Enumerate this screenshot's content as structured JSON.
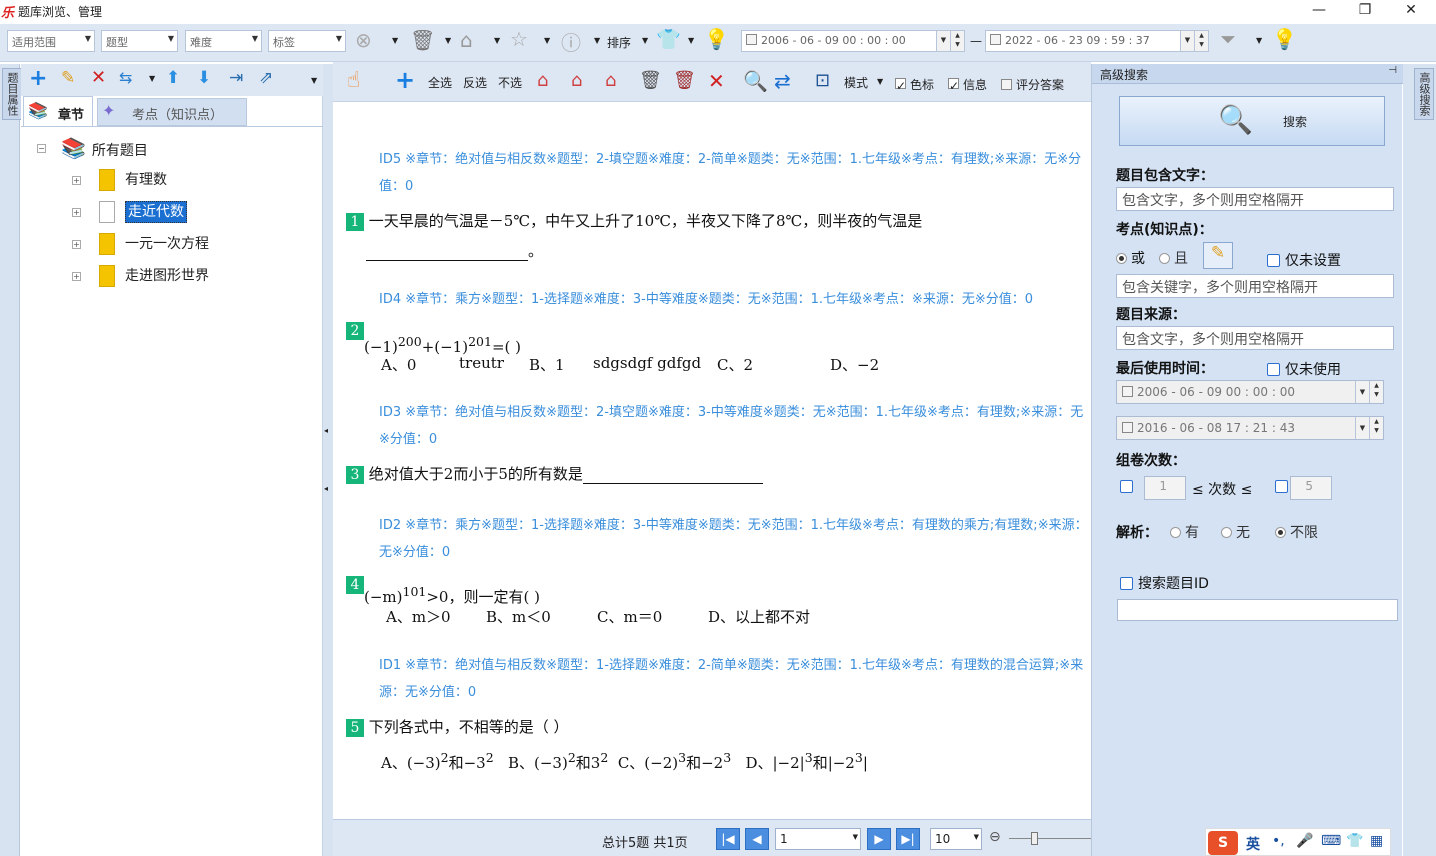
{
  "window": {
    "title": "题库浏览、管理",
    "logo": "乐",
    "min": "—",
    "max": "❐",
    "close": "✕"
  },
  "filters": {
    "scope": "适用范围",
    "qtype": "题型",
    "difficulty": "难度",
    "tag": "标签",
    "sort": "排序",
    "date_start": "2006 - 06 - 09     00 : 00 : 00",
    "date_dash": "—",
    "date_end": "2022 - 06 - 23     09 : 59 : 37"
  },
  "left_strip": {
    "label": "题目属性"
  },
  "left": {
    "tab_chapter": "章节",
    "tab_point": "考点（知识点）",
    "tree": {
      "root": "所有题目",
      "children": [
        "有理数",
        "走近代数",
        "一元一次方程",
        "走进图形世界"
      ]
    }
  },
  "center_tool": {
    "select_all": "全选",
    "invert": "反选",
    "select_none": "不选",
    "mode": "模式",
    "color": "色标",
    "info": "信息",
    "score_answer": "评分答案"
  },
  "questions": [
    {
      "meta": "ID5 ※章节：绝对值与相反数※题型：2-填空题※难度：2-简单※题类：无※范围：1.七年级※考点：有理数;※来源：无※分值：0",
      "num": "1",
      "text": "一天早晨的气温是－5℃，中午又上升了10℃，半夜又下降了8℃，则半夜的气温是",
      "tail": "。"
    },
    {
      "meta": "ID4 ※章节：乘方※题型：1-选择题※难度：3-中等难度※题类：无※范围：1.七年级※考点：※来源：无※分值：0",
      "num": "2",
      "base1": "(−1)",
      "exp1": "200",
      "plus": "+(−1)",
      "exp2": "201",
      "eq": "=(      )",
      "opts": [
        "A、0",
        "treutr",
        "B、1",
        "sdgsdgf gdfgd",
        "C、2",
        "D、−2"
      ]
    },
    {
      "meta": "ID3 ※章节：绝对值与相反数※题型：2-填空题※难度：3-中等难度※题类：无※范围：1.七年级※考点：有理数;※来源：无※分值：0",
      "num": "3",
      "text": "绝对值大于2而小于5的所有数是"
    },
    {
      "meta": "ID2 ※章节：乘方※题型：1-选择题※难度：3-中等难度※题类：无※范围：1.七年级※考点：有理数的乘方;有理数;※来源：无※分值：0",
      "num": "4",
      "base": "(−m)",
      "exp": "101",
      "rest": ">0，则一定有(        )",
      "opts": [
        "A、m＞0",
        "B、m＜0",
        "C、m＝0",
        "D、以上都不对"
      ]
    },
    {
      "meta": "ID1 ※章节：绝对值与相反数※题型：1-选择题※难度：2-简单※题类：无※范围：1.七年级※考点：有理数的混合运算;※来源：无※分值：0",
      "num": "5",
      "text": "下列各式中，不相等的是（      ）"
    }
  ],
  "pager": {
    "summary": "总计5题  共1页",
    "page": "1",
    "page_size": "10"
  },
  "right": {
    "header": "高级搜索",
    "search_btn": "搜索",
    "contains_label": "题目包含文字：",
    "contains_ph": "包含文字，多个则用空格隔开",
    "point_label": "考点(知识点)：",
    "or": "或",
    "and": "且",
    "only_unset": "仅未设置",
    "point_ph": "包含关键字，多个则用空格隔开",
    "source_label": "题目来源：",
    "source_ph": "包含文字，多个则用空格隔开",
    "last_used_label": "最后使用时间：",
    "only_unused": "仅未使用",
    "date1": "2006 - 06 - 09     00 : 00 : 00",
    "date2": "2016 - 06 - 08     17 : 21 : 43",
    "count_label": "组卷次数：",
    "count_min": "1",
    "count_mid": "≤ 次数 ≤",
    "count_max": "5",
    "analysis_label": "解析：",
    "has": "有",
    "none": "无",
    "unlimited": "不限",
    "search_id": "搜索题目ID"
  },
  "right_strip": {
    "label": "高级搜索"
  },
  "ime": {
    "lang": "英",
    "punct": "•,"
  }
}
